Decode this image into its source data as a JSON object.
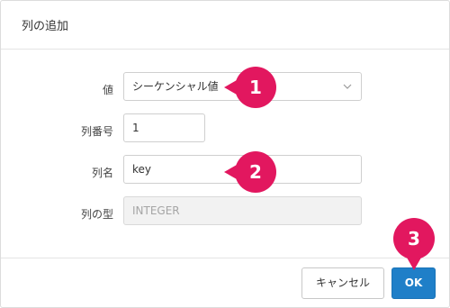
{
  "dialog": {
    "title": "列の追加",
    "fields": {
      "value": {
        "label": "値",
        "selected": "シーケンシャル値"
      },
      "column_number": {
        "label": "列番号",
        "value": "1"
      },
      "column_name": {
        "label": "列名",
        "value": "key"
      },
      "column_type": {
        "label": "列の型",
        "value": "INTEGER"
      }
    },
    "buttons": {
      "cancel": "キャンセル",
      "ok": "OK"
    }
  },
  "annotations": {
    "badge1": "1",
    "badge2": "2",
    "badge3": "3"
  },
  "colors": {
    "accent_button": "#1f7fc8",
    "annotation_badge": "#e2175f"
  },
  "icons": {
    "select_arrow": "chevron-down-icon"
  }
}
